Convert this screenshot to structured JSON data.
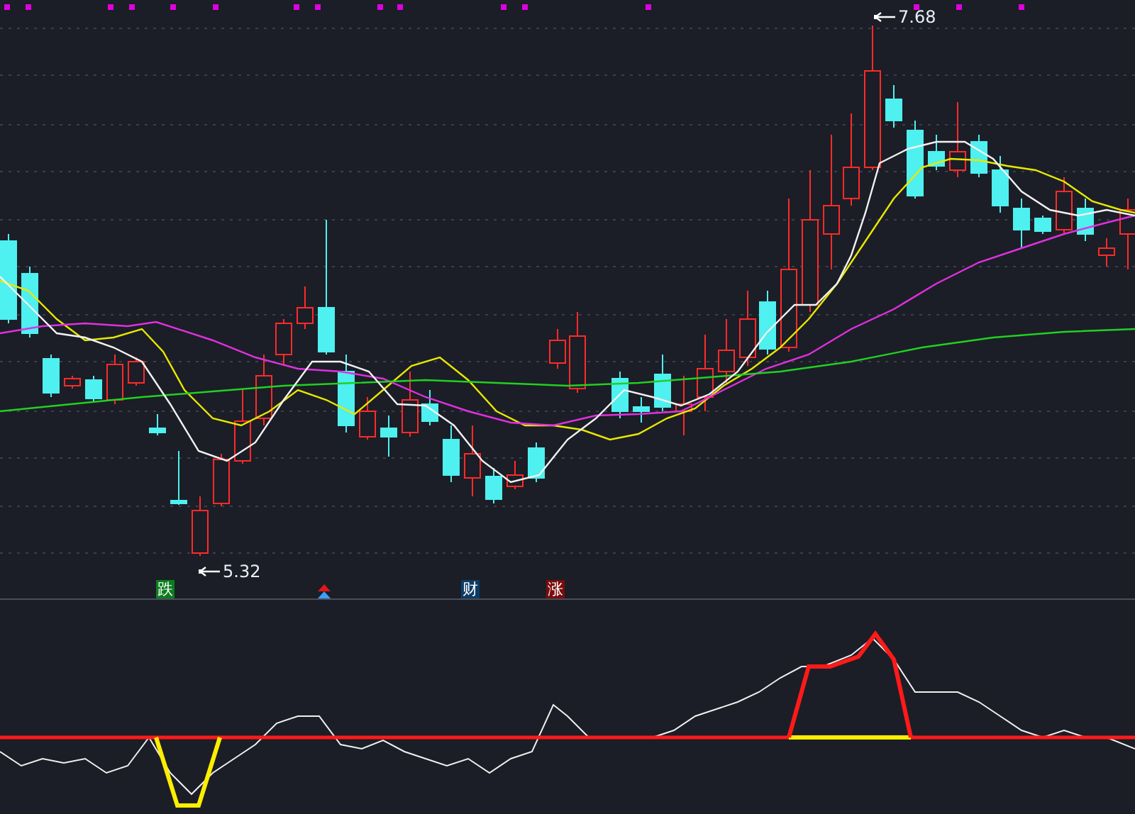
{
  "main_chart": {
    "high_label": "7.68",
    "low_label": "5.32",
    "markers": [
      {
        "kind": "badge",
        "text": "跌",
        "color": "#0b7d1e"
      },
      {
        "kind": "arrow",
        "color": "#e01818"
      },
      {
        "kind": "badge",
        "text": "财",
        "color": "#0d3b66"
      },
      {
        "kind": "badge",
        "text": "涨",
        "color": "#7a0c0c"
      }
    ]
  }
}
